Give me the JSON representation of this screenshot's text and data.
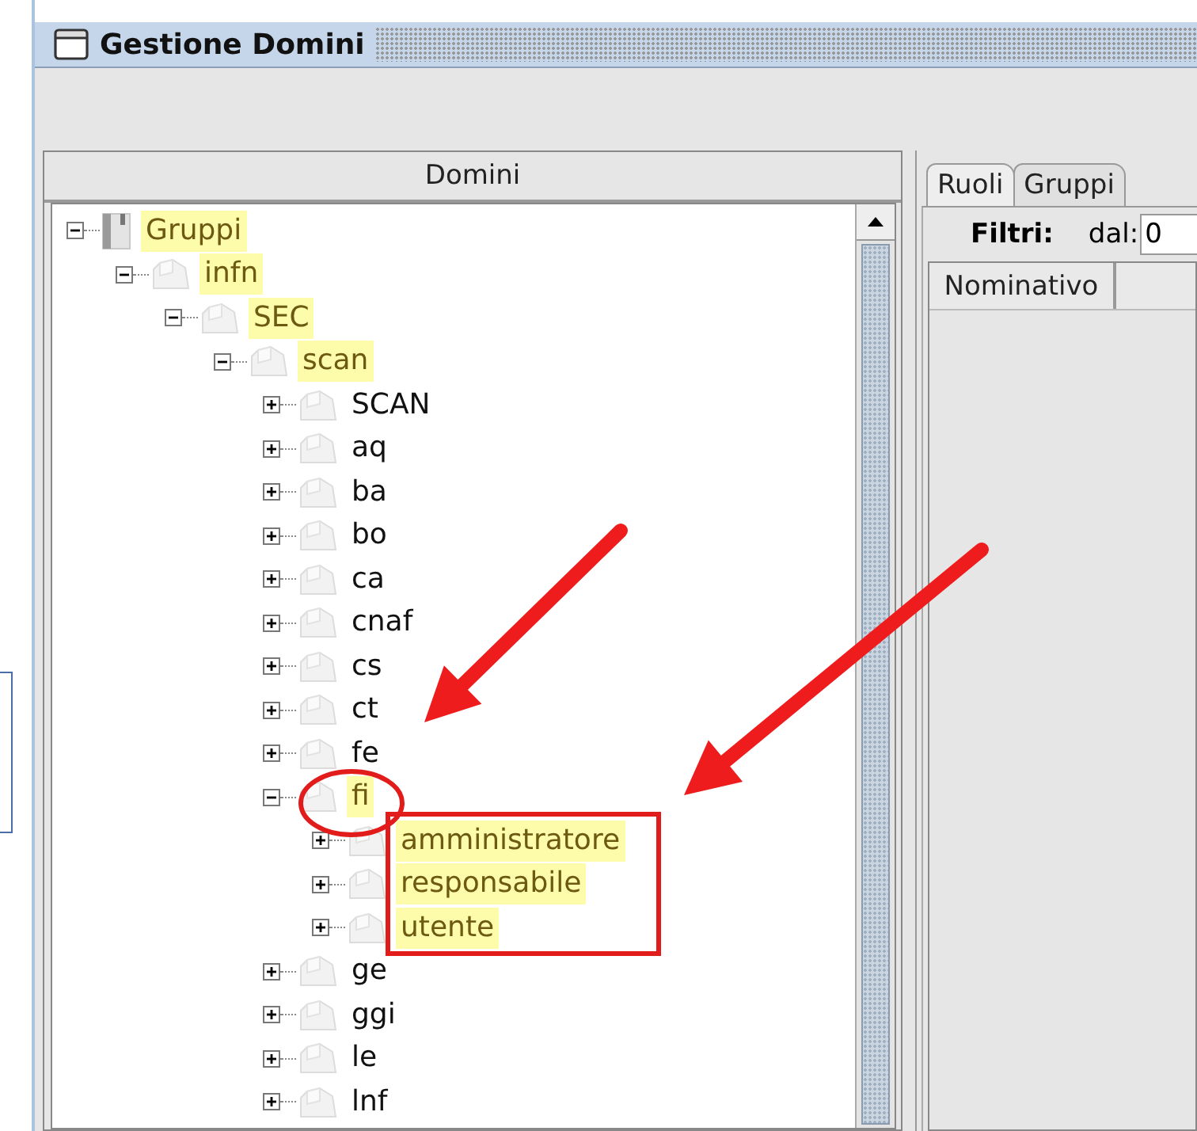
{
  "window": {
    "title": "Gestione Domini"
  },
  "left_panel": {
    "header": "Domini"
  },
  "tree": [
    {
      "label": "Gruppi",
      "kind": "book",
      "highlighted": true,
      "expanded": true,
      "children": [
        {
          "label": "infn",
          "kind": "folder",
          "highlighted": true,
          "expanded": true,
          "children": [
            {
              "label": "SEC",
              "kind": "folder",
              "highlighted": true,
              "expanded": true,
              "children": [
                {
                  "label": "scan",
                  "kind": "folder",
                  "highlighted": true,
                  "expanded": true,
                  "children": [
                    {
                      "label": "SCAN",
                      "kind": "folder",
                      "highlighted": false,
                      "expanded": false
                    },
                    {
                      "label": "aq",
                      "kind": "folder",
                      "highlighted": false,
                      "expanded": false
                    },
                    {
                      "label": "ba",
                      "kind": "folder",
                      "highlighted": false,
                      "expanded": false
                    },
                    {
                      "label": "bo",
                      "kind": "folder",
                      "highlighted": false,
                      "expanded": false
                    },
                    {
                      "label": "ca",
                      "kind": "folder",
                      "highlighted": false,
                      "expanded": false
                    },
                    {
                      "label": "cnaf",
                      "kind": "folder",
                      "highlighted": false,
                      "expanded": false
                    },
                    {
                      "label": "cs",
                      "kind": "folder",
                      "highlighted": false,
                      "expanded": false
                    },
                    {
                      "label": "ct",
                      "kind": "folder",
                      "highlighted": false,
                      "expanded": false
                    },
                    {
                      "label": "fe",
                      "kind": "folder",
                      "highlighted": false,
                      "expanded": false
                    },
                    {
                      "label": "fi",
                      "kind": "folder",
                      "highlighted": true,
                      "expanded": true,
                      "children": [
                        {
                          "label": "amministratore",
                          "kind": "folder",
                          "highlighted": true,
                          "expanded": false
                        },
                        {
                          "label": "responsabile",
                          "kind": "folder",
                          "highlighted": true,
                          "expanded": false
                        },
                        {
                          "label": "utente",
                          "kind": "folder",
                          "highlighted": true,
                          "expanded": false
                        }
                      ]
                    },
                    {
                      "label": "ge",
                      "kind": "folder",
                      "highlighted": false,
                      "expanded": false
                    },
                    {
                      "label": "ggi",
                      "kind": "folder",
                      "highlighted": false,
                      "expanded": false
                    },
                    {
                      "label": "le",
                      "kind": "folder",
                      "highlighted": false,
                      "expanded": false
                    },
                    {
                      "label": "lnf",
                      "kind": "folder",
                      "highlighted": false,
                      "expanded": false
                    }
                  ]
                }
              ]
            }
          ]
        }
      ]
    }
  ],
  "tabs": [
    {
      "label": "Ruoli",
      "selected": true
    },
    {
      "label": "Gruppi",
      "selected": false
    }
  ],
  "filters": {
    "label": "Filtri:",
    "from_label": "dal:",
    "from_value": "0"
  },
  "table": {
    "columns": [
      "Nominativo"
    ]
  },
  "annotations": [
    {
      "kind": "arrow"
    },
    {
      "kind": "arrow"
    },
    {
      "kind": "circle"
    },
    {
      "kind": "rectangle"
    }
  ]
}
